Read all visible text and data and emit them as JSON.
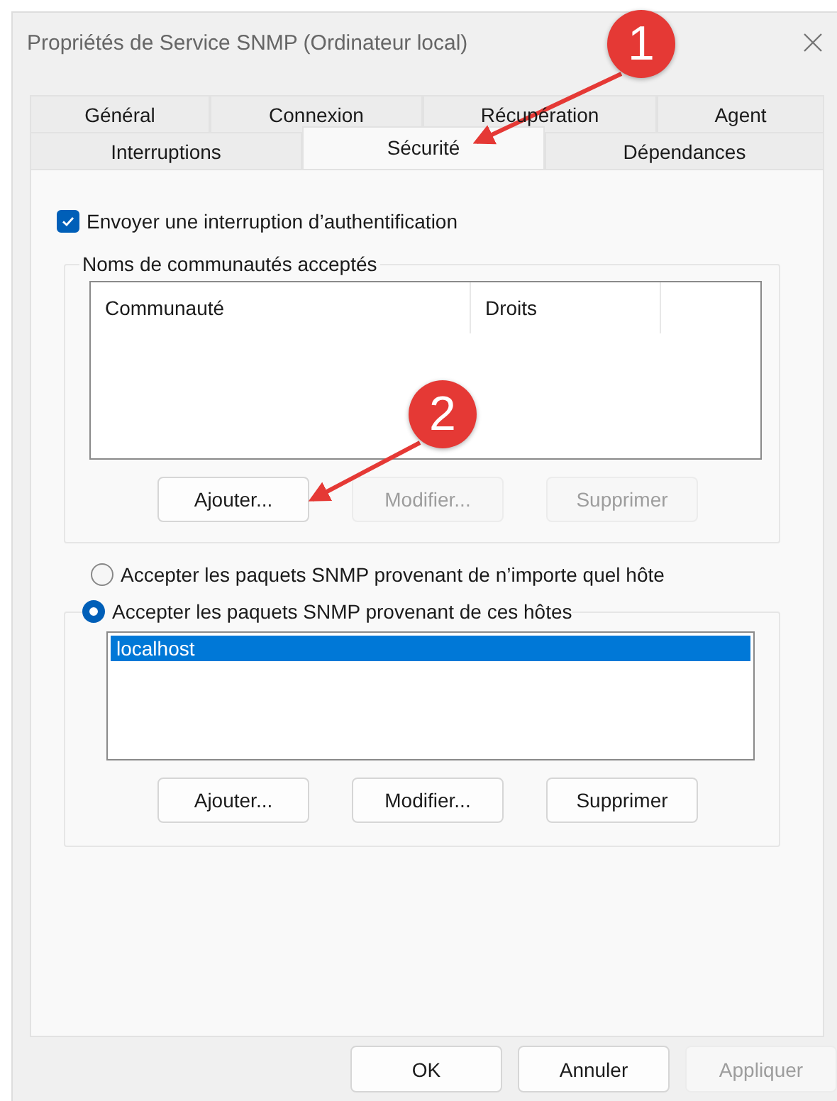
{
  "window": {
    "title": "Propriétés de Service SNMP (Ordinateur local)"
  },
  "tab_rows": [
    [
      {
        "label": "Général",
        "selected": false
      },
      {
        "label": "Connexion",
        "selected": false
      },
      {
        "label": "Récupération",
        "selected": false
      },
      {
        "label": "Agent",
        "selected": false
      }
    ],
    [
      {
        "label": "Interruptions",
        "selected": false
      },
      {
        "label": "Sécurité",
        "selected": true
      },
      {
        "label": "Dépendances",
        "selected": false
      }
    ]
  ],
  "trap_checkbox": {
    "label": "Envoyer une interruption d’authentification",
    "checked": true
  },
  "communities": {
    "title": "Noms de communautés acceptés",
    "columns": [
      "Communauté",
      "Droits"
    ],
    "buttons": [
      {
        "label": "Ajouter...",
        "disabled": false
      },
      {
        "label": "Modifier...",
        "disabled": true
      },
      {
        "label": "Supprimer",
        "disabled": true
      }
    ]
  },
  "host_options": [
    {
      "label": "Accepter les paquets SNMP provenant de n’importe quel hôte",
      "selected": false
    },
    {
      "label": "Accepter les paquets SNMP provenant de ces hôtes",
      "selected": true
    }
  ],
  "hosts": {
    "rows": [
      {
        "label": "localhost",
        "selected": true
      }
    ],
    "buttons": [
      {
        "label": "Ajouter...",
        "disabled": false
      },
      {
        "label": "Modifier...",
        "disabled": false
      },
      {
        "label": "Supprimer",
        "disabled": false
      }
    ]
  },
  "footer_buttons": [
    {
      "label": "OK",
      "disabled": false
    },
    {
      "label": "Annuler",
      "disabled": false
    },
    {
      "label": "Appliquer",
      "disabled": true
    }
  ],
  "annotations": [
    {
      "number": "1"
    },
    {
      "number": "2"
    }
  ]
}
